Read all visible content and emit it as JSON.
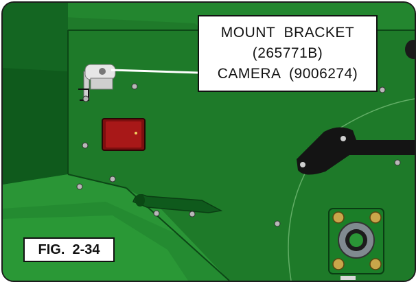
{
  "callout": {
    "line1": "MOUNT  BRACKET",
    "line2": "(265771B)",
    "line3": "CAMERA  (9006274)"
  },
  "figure_label": "FIG.  2-34",
  "colors": {
    "machine_green": "#1f7a2a",
    "dark_green": "#115a1d",
    "light_green": "#2e9a38",
    "reflector_red": "#9a1414",
    "bearing_gold": "#c9a64a"
  }
}
